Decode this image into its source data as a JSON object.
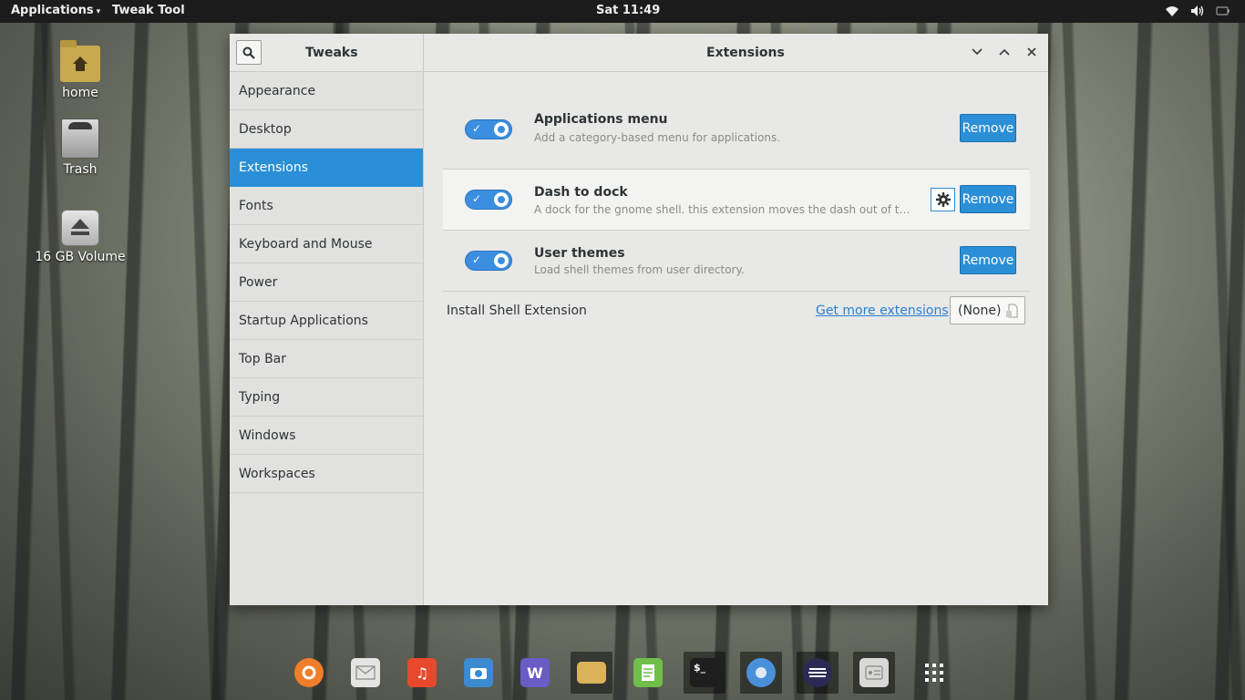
{
  "topbar": {
    "applications_label": "Applications",
    "active_app": "Tweak Tool",
    "clock": "Sat 11:49",
    "tray_icons": [
      "wifi-icon",
      "volume-icon",
      "battery-icon"
    ]
  },
  "desktop": {
    "icons": [
      {
        "label": "home",
        "icon": "home-folder-icon"
      },
      {
        "label": "Trash",
        "icon": "trash-icon"
      },
      {
        "label": "16 GB Volume",
        "icon": "removable-drive-icon"
      }
    ]
  },
  "window": {
    "sidebar_title": "Tweaks",
    "content_title": "Extensions",
    "sidebar_items": [
      {
        "label": "Appearance"
      },
      {
        "label": "Desktop"
      },
      {
        "label": "Extensions",
        "selected": true
      },
      {
        "label": "Fonts"
      },
      {
        "label": "Keyboard and Mouse"
      },
      {
        "label": "Power"
      },
      {
        "label": "Startup Applications"
      },
      {
        "label": "Top Bar"
      },
      {
        "label": "Typing"
      },
      {
        "label": "Windows"
      },
      {
        "label": "Workspaces"
      }
    ],
    "extensions": [
      {
        "name": "Applications menu",
        "description": "Add a category-based menu for applications.",
        "enabled": true,
        "remove_label": "Remove",
        "has_settings": false
      },
      {
        "name": "Dash to dock",
        "description": "A dock for the gnome shell. this extension moves the dash out of the overvi...",
        "enabled": true,
        "remove_label": "Remove",
        "has_settings": true
      },
      {
        "name": "User themes",
        "description": "Load shell themes from user directory.",
        "enabled": true,
        "remove_label": "Remove",
        "has_settings": false
      }
    ],
    "install": {
      "label": "Install Shell Extension",
      "more_link": "Get more extensions",
      "file_value": "(None)"
    }
  },
  "dock": {
    "items": [
      {
        "icon": "firefox-icon",
        "color": "#f07d2a"
      },
      {
        "icon": "mail-icon",
        "color": "#e4e4e2"
      },
      {
        "icon": "music-icon",
        "color": "#e8482c"
      },
      {
        "icon": "camera-icon",
        "color": "#3c8ad0"
      },
      {
        "icon": "writer-icon",
        "color": "#6b5bc4"
      },
      {
        "icon": "files-icon",
        "color": "#d9b25a"
      },
      {
        "icon": "text-editor-icon",
        "color": "#6fbf4a"
      },
      {
        "icon": "terminal-icon",
        "color": "#1e1e1e"
      },
      {
        "icon": "chromium-icon",
        "color": "#4a90d9"
      },
      {
        "icon": "eclipse-icon",
        "color": "#2c2a55"
      },
      {
        "icon": "system-settings-icon",
        "color": "#d8d8d6"
      },
      {
        "icon": "show-apps-icon",
        "color": "#ffffff"
      }
    ]
  },
  "colors": {
    "accent": "#2a8fd6",
    "topbar_bg": "#1c1c1c",
    "window_bg": "#e8e8e7"
  }
}
